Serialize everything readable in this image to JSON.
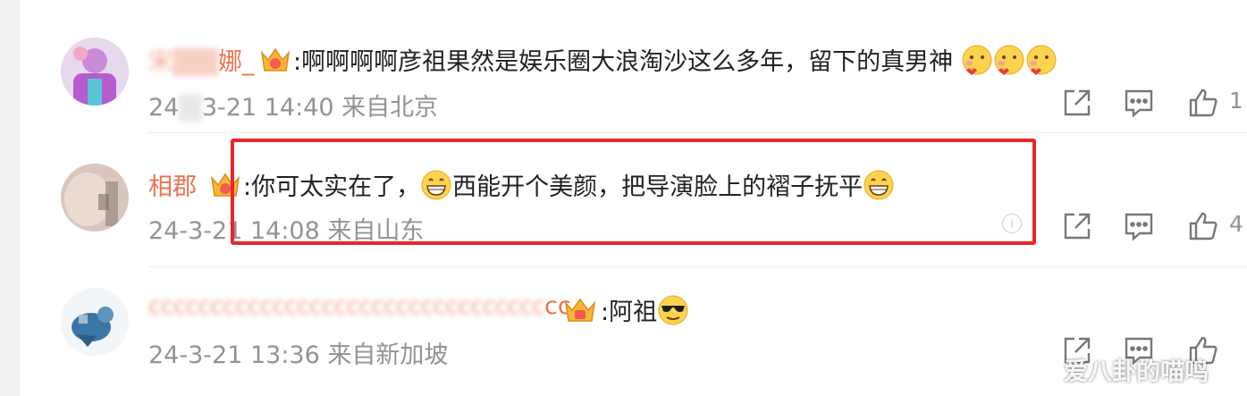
{
  "comments": [
    {
      "name_hidden": "宋",
      "name_visible_end": "娜_",
      "text": ":啊啊啊啊彦祖果然是娱乐圈大浪淘沙这么多年，留下的真男神",
      "emojis": [
        "blush-heart-emoji",
        "blush-heart-emoji",
        "blush-heart-emoji"
      ],
      "date_start": "24",
      "date_end": "3-21 14:40",
      "location": "来自北京",
      "like_count": "1"
    },
    {
      "name": "相郡",
      "text_part1": ":你可太实在了，",
      "text_part2": "西能开个美颜，把导演脸上的褶子抚平",
      "date": "24-3-21 14:08",
      "location": "来自山东",
      "like_count": "4"
    },
    {
      "name_blurred": "cccccccccccccccccccccccccccccccc",
      "name_visible_end": "cc",
      "text": ":阿祖",
      "date": "24-3-21 13:36",
      "location": "来自新加坡"
    }
  ],
  "watermark": "爱八卦的喵鸣",
  "colors": {
    "username": "#eb7350",
    "highlight": "#e8262a",
    "meta": "#939393"
  }
}
